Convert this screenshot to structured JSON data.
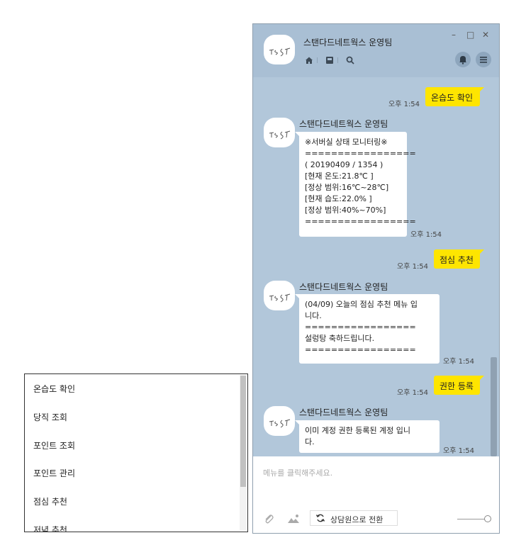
{
  "menu": {
    "items": [
      "온습도 확인",
      "당직 조회",
      "포인트 조회",
      "포인트 관리",
      "점심 추천",
      "저녁 추천"
    ]
  },
  "header": {
    "title": "스탠다드네트웍스 운영팀",
    "avatar_text": "TEST",
    "icons": [
      "home-icon",
      "inbox-icon",
      "search-icon",
      "bell-icon",
      "menu-icon"
    ],
    "window_controls": {
      "minimize": "–",
      "maximize": "□",
      "close": "✕"
    }
  },
  "messages": {
    "m1": {
      "text": "온습도 확인",
      "time": "오후 1:54"
    },
    "m2": {
      "sender": "스탠다드네트웍스 운영팀",
      "lines": [
        "※서버실 상태 모니터링※",
        "=================",
        "( 20190409 / 1354 )",
        "[현재 온도:21.8℃ ]",
        "[정상 범위:16℃~28℃]",
        "[현재 습도:22.0% ]",
        "[정상 범위:40%~70%]",
        "================="
      ],
      "time": "오후 1:54"
    },
    "m3": {
      "text": "점심 추천",
      "time": "오후 1:54"
    },
    "m4": {
      "sender": "스탠다드네트웍스 운영팀",
      "lines": [
        "(04/09) 오늘의 점심 추천 메뉴 입",
        "니다.",
        "=================",
        "설렁탕 축하드립니다.",
        "================="
      ],
      "time": "오후 1:54"
    },
    "m5": {
      "text": "권한 등록",
      "time": "오후 1:54"
    },
    "m6": {
      "sender": "스탠다드네트웍스 운영팀",
      "lines": [
        "이미 계정 권한 등록된 계정 입니",
        "다."
      ],
      "time": "오후 1:54"
    }
  },
  "input": {
    "placeholder": "메뉴를 클릭해주세요.",
    "convert_label": "상담원으로 전환",
    "icons": [
      "attach-icon",
      "image-icon",
      "refresh-icon"
    ]
  },
  "colors": {
    "chat_bg": "#b2c7da",
    "my_bubble": "#fee500",
    "bot_bubble": "#ffffff"
  }
}
